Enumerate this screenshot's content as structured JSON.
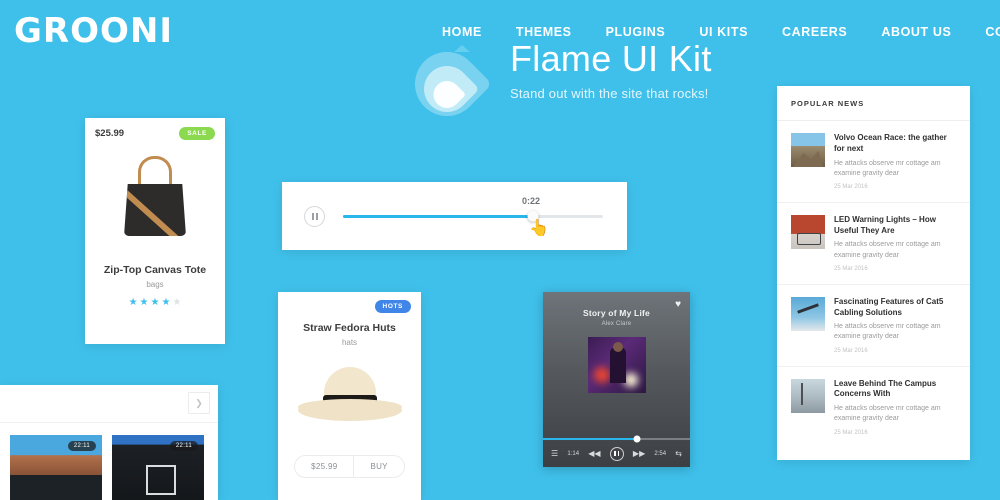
{
  "theme": {
    "background": "#3fc0ea",
    "accent": "#29b6ea",
    "sale_badge": "#8bd94f",
    "hots_badge": "#3f86e8",
    "star_on": "#3fc0ea",
    "star_off": "#dfe3e6"
  },
  "header": {
    "logo": "GROONI",
    "nav": [
      {
        "label": "HOME",
        "active": true
      },
      {
        "label": "THEMES",
        "active": false
      },
      {
        "label": "PLUGINS",
        "active": false
      },
      {
        "label": "UI KITS",
        "active": false
      },
      {
        "label": "CAREERS",
        "active": false
      },
      {
        "label": "ABOUT US",
        "active": false
      },
      {
        "label": "CONTACT",
        "active": false
      }
    ]
  },
  "hero": {
    "title": "Flame UI Kit",
    "subtitle": "Stand out with the site that rocks!",
    "logo_icon": "flame-icon"
  },
  "product_card": {
    "price": "$25.99",
    "badge": "SALE",
    "name": "Zip-Top Canvas Tote",
    "category": "bags",
    "rating": 4,
    "rating_max": 5,
    "image_icon": "tote-bag-image"
  },
  "audio_player": {
    "play_state": "pause",
    "time": "0:22",
    "progress_percent": 73,
    "cursor_icon": "hand-pointer-icon"
  },
  "hat_card": {
    "badge": "HOTS",
    "name": "Straw Fedora Huts",
    "category": "hats",
    "price": "$25.99",
    "buy_label": "BUY",
    "image_icon": "straw-hat-image"
  },
  "music_card": {
    "title": "Story of My Life",
    "artist": "Alex Clare",
    "favorite_icon": "heart-icon",
    "progress_percent": 64,
    "elapsed": "1:14",
    "duration": "2:54",
    "controls": {
      "equalizer_icon": "equalizer-icon",
      "rewind_icon": "rewind-icon",
      "pause_icon": "pause-icon",
      "forward_icon": "forward-icon",
      "shuffle_icon": "shuffle-icon"
    }
  },
  "news_panel": {
    "heading": "POPULAR NEWS",
    "items": [
      {
        "title": "Volvo Ocean Race: the gather for next",
        "desc": "He attacks observe mr cottage am examine gravity dear",
        "date": "25 Mar 2016",
        "thumb": "mountain-thumbnail"
      },
      {
        "title": "LED Warning Lights – How Useful They Are",
        "desc": "He attacks observe mr cottage am examine gravity dear",
        "date": "25 Mar 2016",
        "thumb": "bicycle-thumbnail"
      },
      {
        "title": "Fascinating Features of Cat5 Cabling Solutions",
        "desc": "He attacks observe mr cottage am examine gravity dear",
        "date": "25 Mar 2016",
        "thumb": "drone-thumbnail"
      },
      {
        "title": "Leave Behind The Campus Concerns With",
        "desc": "He attacks observe mr cottage am examine gravity dear",
        "date": "25 Mar 2016",
        "thumb": "coast-thumbnail"
      }
    ]
  },
  "gallery_card": {
    "next_icon": "chevron-right-icon",
    "thumbs": [
      {
        "duration": "22:11",
        "image": "canyon-tent-thumbnail"
      },
      {
        "duration": "22:11",
        "image": "city-night-thumbnail"
      }
    ]
  }
}
